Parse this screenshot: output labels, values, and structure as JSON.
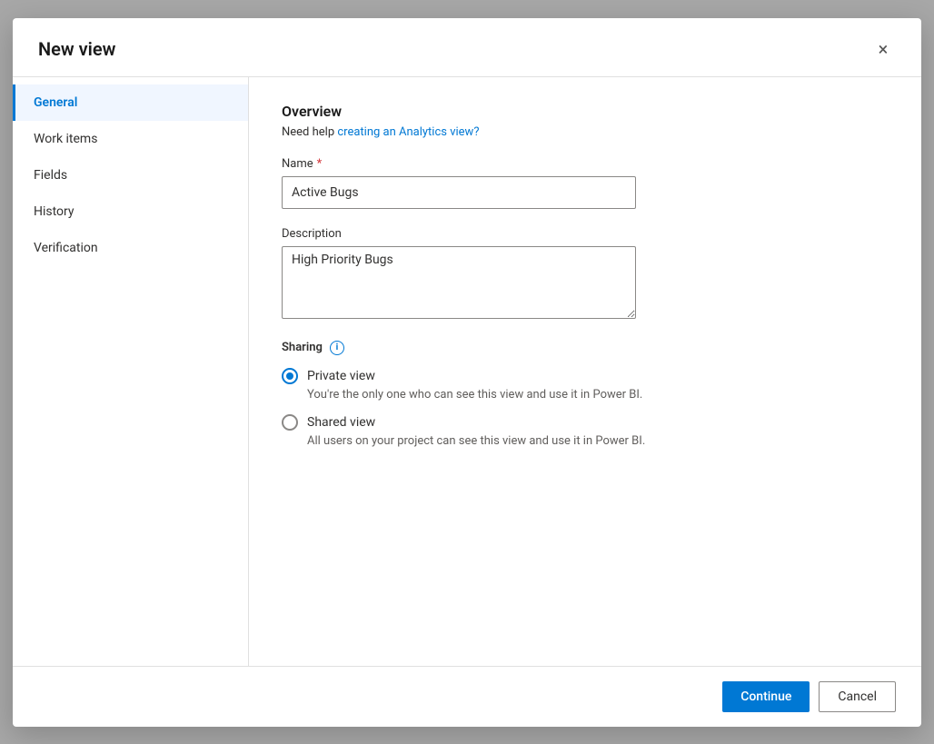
{
  "dialog": {
    "title": "New view",
    "close_label": "×"
  },
  "sidebar": {
    "items": [
      {
        "id": "general",
        "label": "General",
        "active": true
      },
      {
        "id": "work-items",
        "label": "Work items",
        "active": false
      },
      {
        "id": "fields",
        "label": "Fields",
        "active": false
      },
      {
        "id": "history",
        "label": "History",
        "active": false
      },
      {
        "id": "verification",
        "label": "Verification",
        "active": false
      }
    ]
  },
  "main": {
    "overview_title": "Overview",
    "help_text_prefix": "Need help ",
    "help_link_text": "creating an Analytics view?",
    "name_label": "Name",
    "name_required": true,
    "name_value": "Active Bugs",
    "description_label": "Description",
    "description_value": "High Priority Bugs",
    "sharing_label": "Sharing",
    "info_icon": "i",
    "sharing_options": [
      {
        "id": "private",
        "label": "Private view",
        "description": "You're the only one who can see this view and use it in Power BI.",
        "selected": true
      },
      {
        "id": "shared",
        "label": "Shared view",
        "description": "All users on your project can see this view and use it in Power BI.",
        "selected": false
      }
    ]
  },
  "footer": {
    "continue_label": "Continue",
    "cancel_label": "Cancel"
  }
}
